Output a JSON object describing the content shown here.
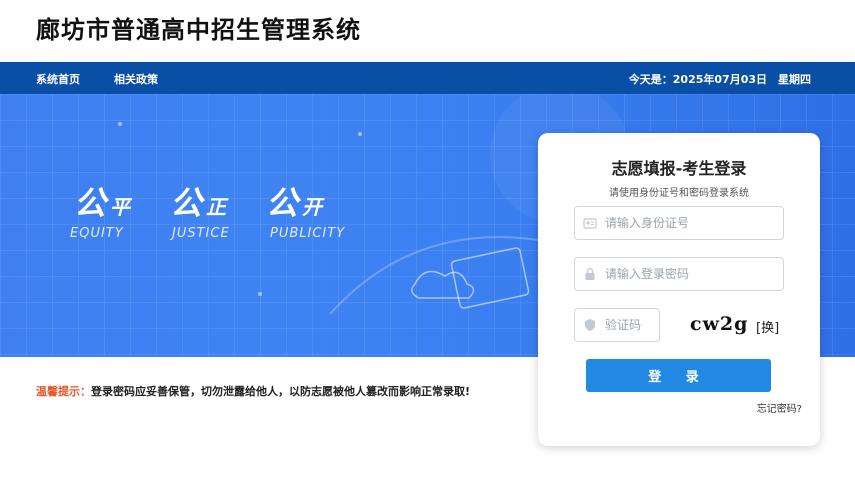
{
  "header": {
    "title": "廊坊市普通高中招生管理系统"
  },
  "nav": {
    "items": [
      {
        "label": "系统首页"
      },
      {
        "label": "相关政策"
      }
    ],
    "date_text": "今天是：2025年07月03日　星期四"
  },
  "banner": {
    "motto": [
      {
        "big": "公",
        "small": "平",
        "en": "EQUITY"
      },
      {
        "big": "公",
        "small": "正",
        "en": "JUSTICE"
      },
      {
        "big": "公",
        "small": "开",
        "en": "PUBLICITY"
      }
    ]
  },
  "tip": {
    "label": "温馨提示：",
    "text": "登录密码应妥善保管，切勿泄露给他人，以防志愿被他人篡改而影响正常录取!"
  },
  "login": {
    "title": "志愿填报-考生登录",
    "subtitle": "请使用身份证号和密码登录系统",
    "id_placeholder": "请输入身份证号",
    "password_placeholder": "请输入登录密码",
    "captcha_placeholder": "验证码",
    "captcha_text": "cw2g",
    "captcha_swap": "[换]",
    "submit": "登 录",
    "forgot": "忘记密码?"
  },
  "colors": {
    "nav_bg": "#0a4fa6",
    "banner_bg": "#3f7ff0",
    "button": "#2289e3",
    "tip_label": "#e2592a"
  }
}
